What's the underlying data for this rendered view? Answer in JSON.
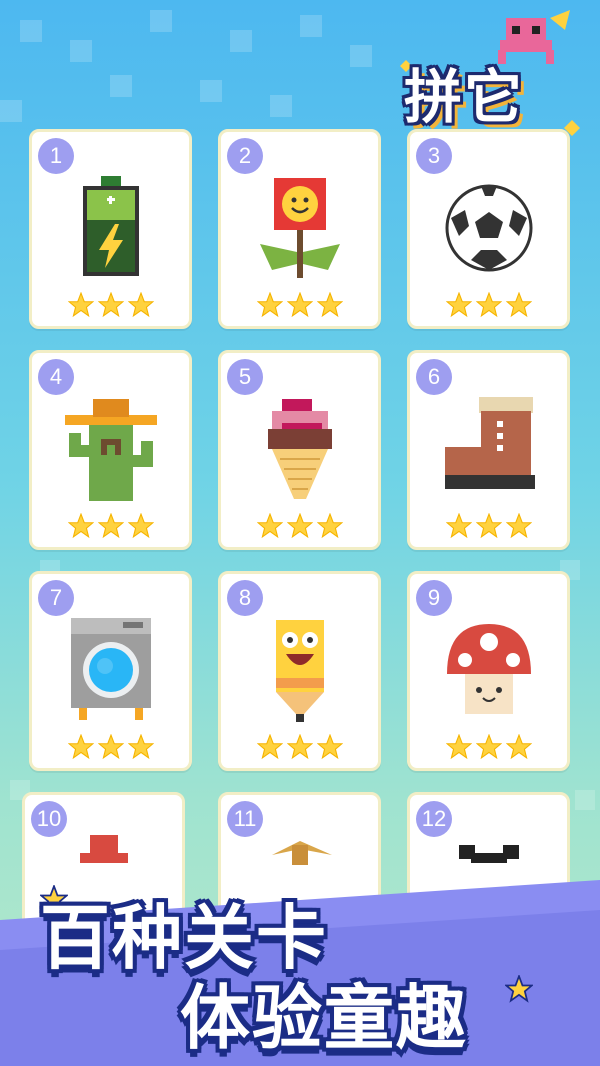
{
  "logo": {
    "title": "拼它"
  },
  "levels": [
    {
      "number": "1",
      "item": "battery-icon",
      "stars": 3
    },
    {
      "number": "2",
      "item": "flower-icon",
      "stars": 3
    },
    {
      "number": "3",
      "item": "soccer-ball-icon",
      "stars": 3
    },
    {
      "number": "4",
      "item": "cactus-icon",
      "stars": 3
    },
    {
      "number": "5",
      "item": "ice-cream-icon",
      "stars": 3
    },
    {
      "number": "6",
      "item": "boot-icon",
      "stars": 3
    },
    {
      "number": "7",
      "item": "washing-machine-icon",
      "stars": 3
    },
    {
      "number": "8",
      "item": "pencil-icon",
      "stars": 3
    },
    {
      "number": "9",
      "item": "mushroom-icon",
      "stars": 3
    },
    {
      "number": "10",
      "item": "hat-icon",
      "stars": 0
    },
    {
      "number": "11",
      "item": "pickaxe-icon",
      "stars": 0
    },
    {
      "number": "12",
      "item": "panda-icon",
      "stars": 0
    }
  ],
  "slogan": {
    "line1": "百种关卡",
    "line2": "体验童趣"
  },
  "colors": {
    "star": "#ffd23f",
    "badge": "#9e9ef0",
    "slogan_outline": "#1b2c86"
  }
}
